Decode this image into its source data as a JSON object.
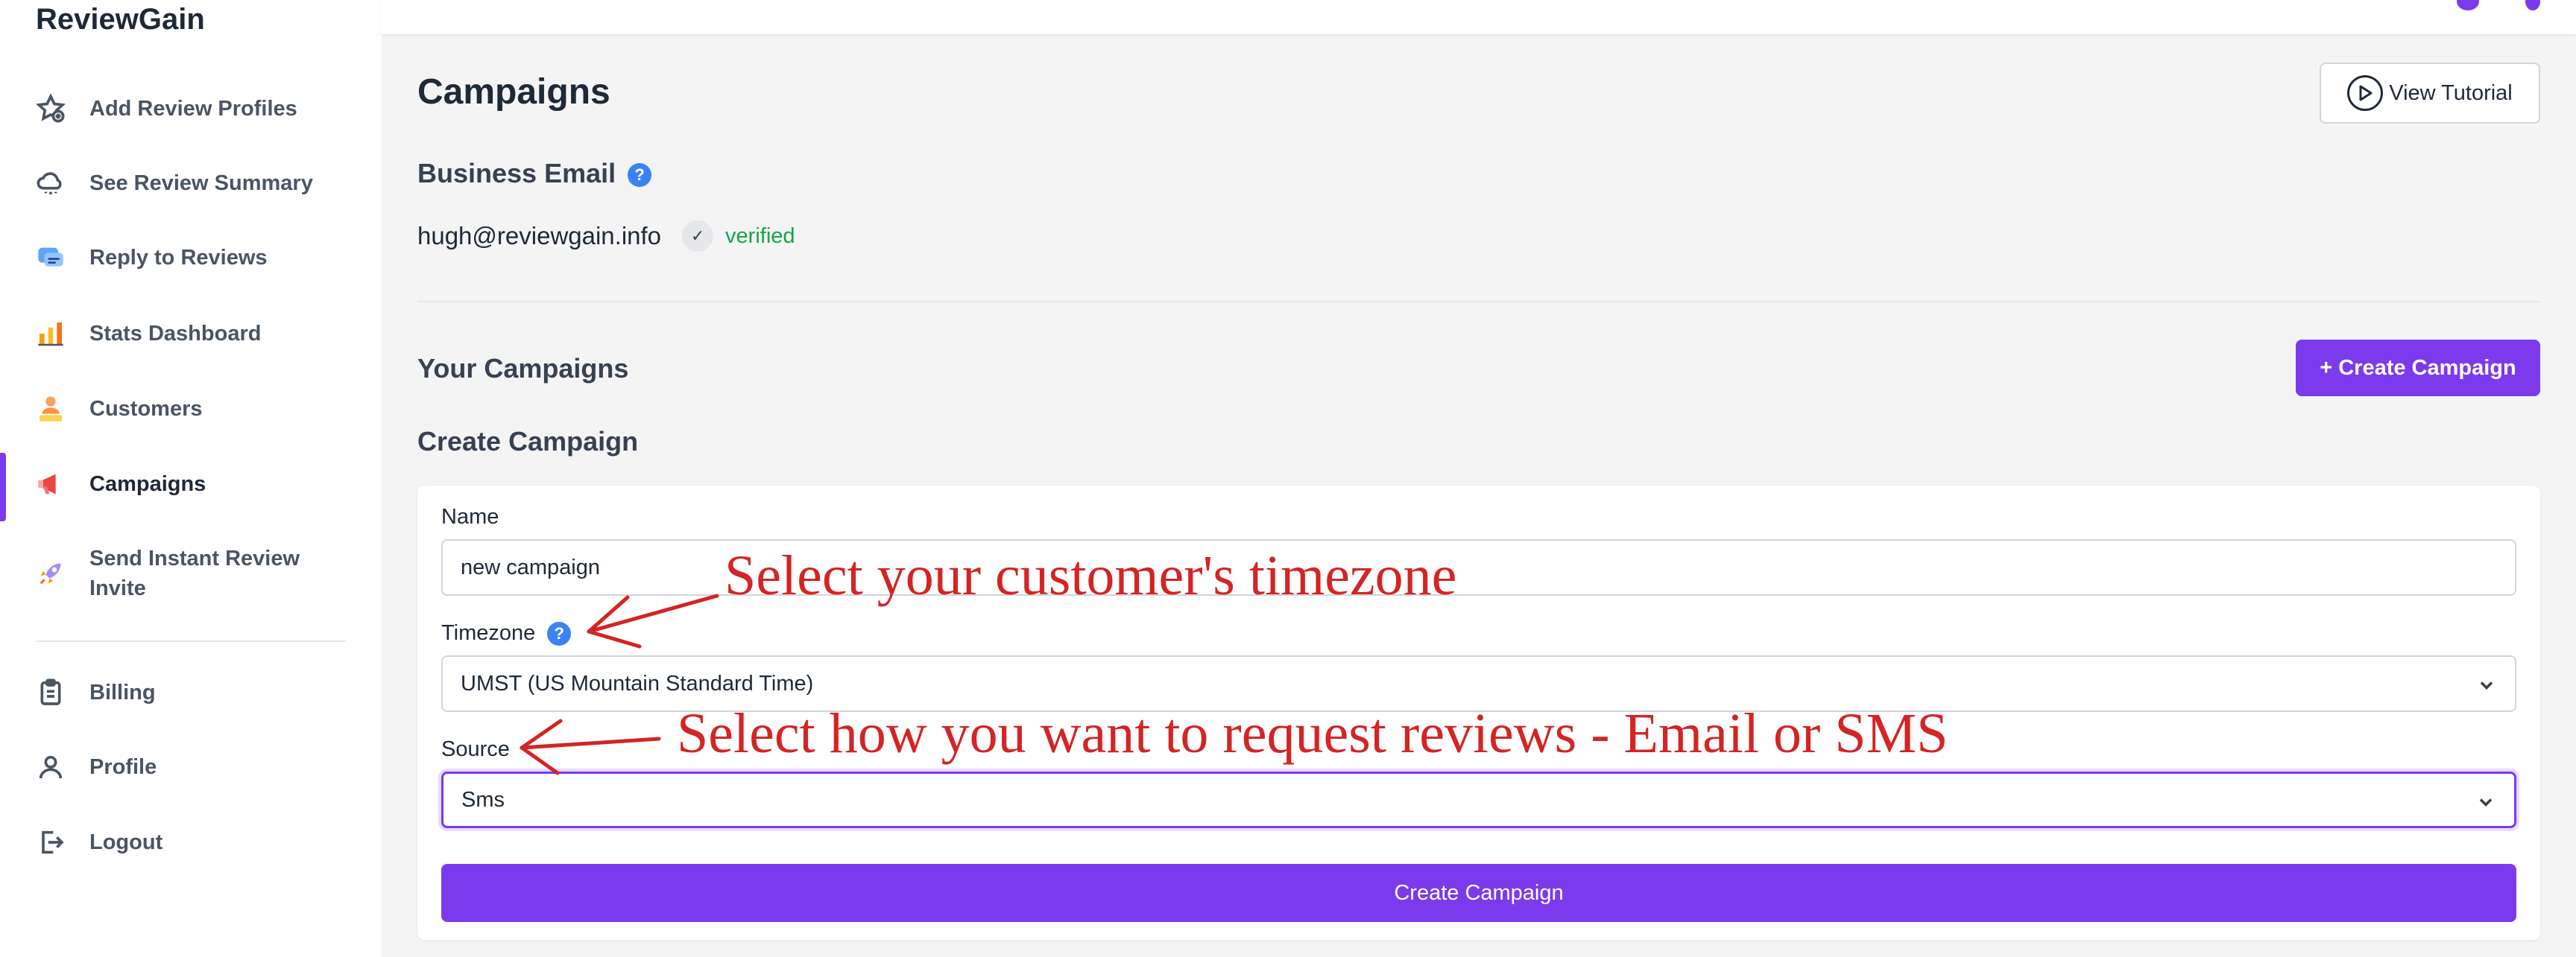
{
  "app": {
    "brand": "ReviewGain"
  },
  "sidebar": {
    "items": [
      {
        "label": "Add Review Profiles",
        "icon": "star-plus-icon"
      },
      {
        "label": "See Review Summary",
        "icon": "cloud-icon"
      },
      {
        "label": "Reply to Reviews",
        "icon": "chat-bubble-icon"
      },
      {
        "label": "Stats Dashboard",
        "icon": "bar-chart-icon"
      },
      {
        "label": "Customers",
        "icon": "people-icon"
      },
      {
        "label": "Campaigns",
        "icon": "megaphone-icon",
        "active": true
      },
      {
        "label": "Send Instant Review",
        "label2": "Invite",
        "icon": "rocket-icon"
      },
      {
        "label": "Billing",
        "icon": "clipboard-icon"
      },
      {
        "label": "Profile",
        "icon": "user-icon"
      },
      {
        "label": "Logout",
        "icon": "logout-icon"
      }
    ]
  },
  "header": {
    "title": "Campaigns",
    "tutorial_label": "View Tutorial"
  },
  "business_email": {
    "title": "Business Email",
    "help": "?",
    "email": "hugh@reviewgain.info",
    "check": "✓",
    "status": "verified"
  },
  "campaigns": {
    "title": "Your Campaigns",
    "create_button": "+ Create Campaign",
    "form_title": "Create Campaign"
  },
  "form": {
    "name_label": "Name",
    "name_value": "new campaign",
    "timezone_label": "Timezone",
    "timezone_help": "?",
    "timezone_value": "UMST (US Mountain Standard Time)",
    "source_label": "Source",
    "source_value": "Sms",
    "submit_label": "Create Campaign"
  },
  "annotations": {
    "timezone_note": "Select your customer's timezone",
    "source_note": "Select how you want to request reviews - Email or SMS"
  },
  "colors": {
    "accent": "#7c3aed",
    "verified": "#16a34a",
    "annotation": "#d42424",
    "help": "#3b82f6"
  }
}
